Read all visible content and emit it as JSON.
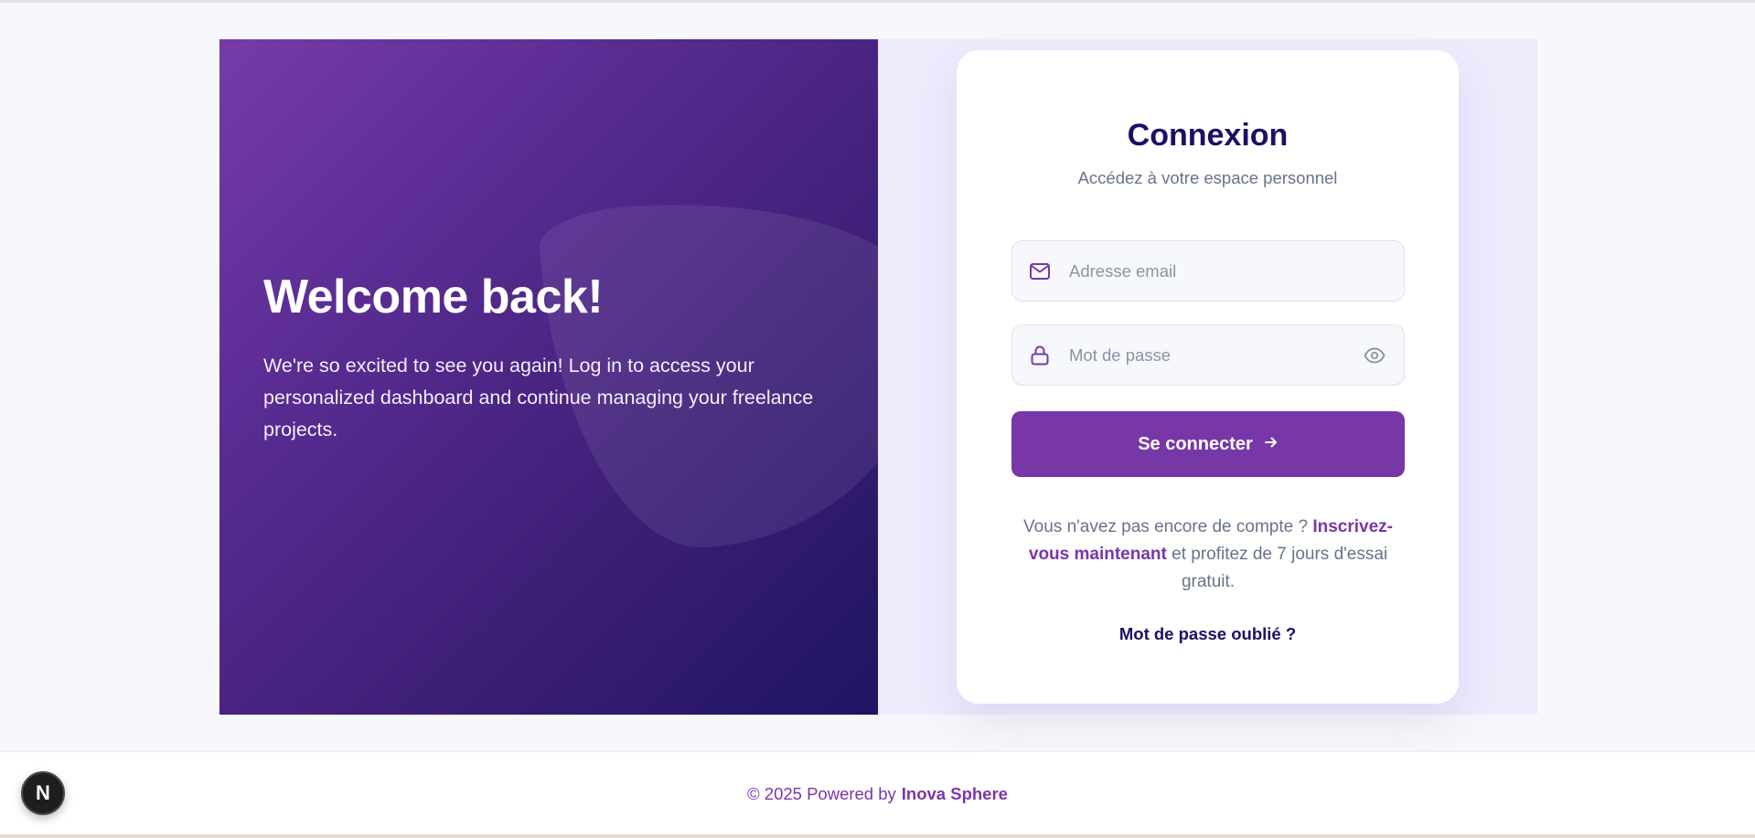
{
  "hero": {
    "title": "Welcome back!",
    "text": "We're so excited to see you again! Log in to access your personalized dashboard and continue managing your freelance projects."
  },
  "login": {
    "title": "Connexion",
    "subtitle": "Accédez à votre espace personnel",
    "email_placeholder": "Adresse email",
    "email_value": "",
    "password_placeholder": "Mot de passe",
    "password_value": "",
    "submit_label": "Se connecter",
    "signup_prefix": "Vous n'avez pas encore de compte ? ",
    "signup_link": "Inscrivez-vous maintenant",
    "signup_suffix": " et profitez de 7 jours d'essai gratuit.",
    "forgot_label": "Mot de passe oublié ?",
    "icons": {
      "email": "mail-icon",
      "password": "lock-icon",
      "toggle": "eye-icon",
      "submit": "arrow-right-icon"
    }
  },
  "footer": {
    "prefix": "© 2025 Powered by",
    "brand": "Inova Sphere"
  },
  "badge": {
    "label": "N"
  },
  "colors": {
    "primary": "#7837a7",
    "heading": "#1b1065",
    "gradient_start": "#763ba7",
    "gradient_end": "#1f1463"
  }
}
